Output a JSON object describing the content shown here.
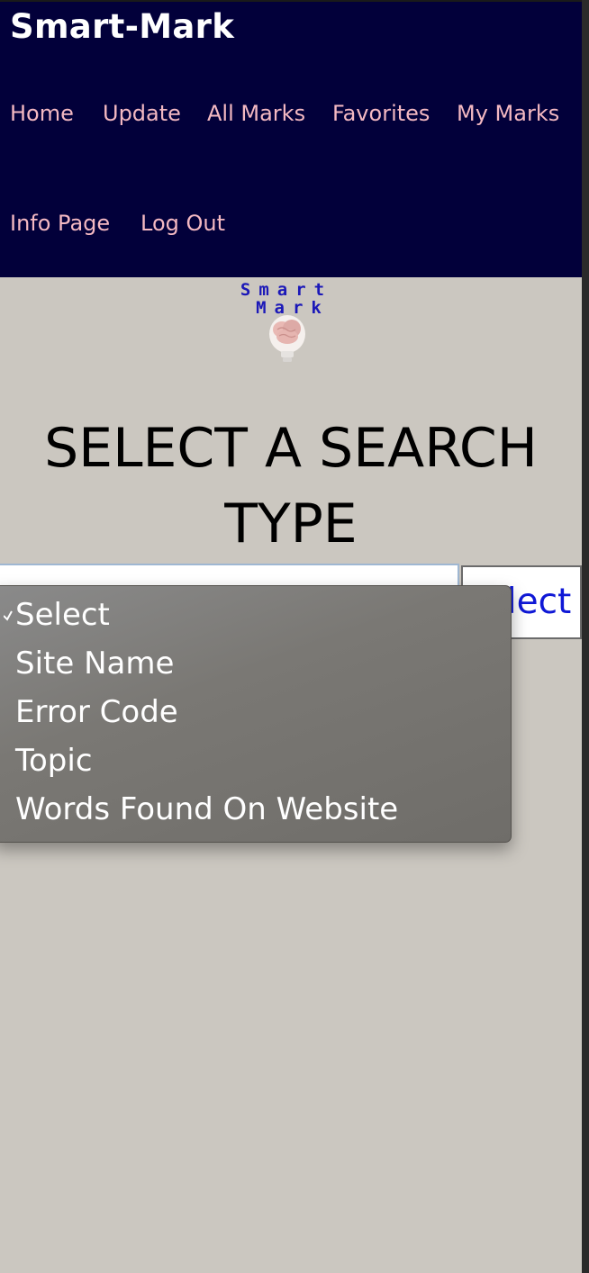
{
  "header": {
    "brand": "Smart-Mark",
    "nav": [
      "Home",
      "Update",
      "All Marks",
      "Favorites",
      "My Marks",
      "Info Page",
      "Log Out"
    ]
  },
  "logo": {
    "line1": "Smart",
    "line2": "Mark"
  },
  "page_title": {
    "line1": "SELECT A SEARCH",
    "line2": "TYPE"
  },
  "search": {
    "button_label": "Select",
    "dropdown_options": [
      "Select",
      "Site Name",
      "Error Code",
      "Topic",
      "Words Found On Website"
    ],
    "selected_option": "Select"
  }
}
